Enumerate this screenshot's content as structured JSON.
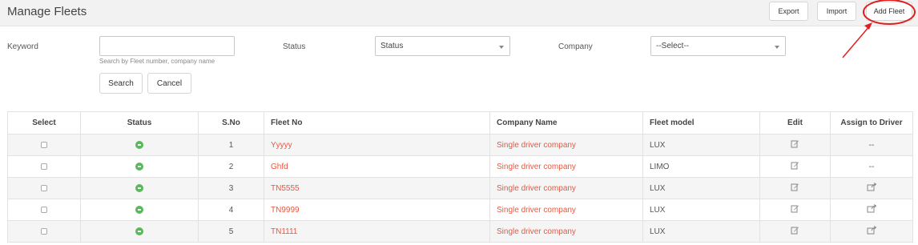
{
  "header": {
    "title": "Manage Fleets",
    "export_label": "Export",
    "import_label": "Import",
    "add_label": "Add Fleet"
  },
  "filters": {
    "keyword_label": "Keyword",
    "keyword_value": "",
    "keyword_hint": "Search by Fleet number, company name",
    "status_label": "Status",
    "status_selected": "Status",
    "company_label": "Company",
    "company_selected": "--Select--",
    "search_label": "Search",
    "cancel_label": "Cancel"
  },
  "table": {
    "headers": [
      "Select",
      "Status",
      "S.No",
      "Fleet No",
      "Company Name",
      "Fleet model",
      "Edit",
      "Assign to Driver"
    ],
    "rows": [
      {
        "sno": "1",
        "fleet_no": "Yyyyy",
        "company": "Single driver company",
        "model": "LUX",
        "assign": "--"
      },
      {
        "sno": "2",
        "fleet_no": "Ghfd",
        "company": "Single driver company",
        "model": "LIMO",
        "assign": "--"
      },
      {
        "sno": "3",
        "fleet_no": "TN5555",
        "company": "Single driver company",
        "model": "LUX",
        "assign": ""
      },
      {
        "sno": "4",
        "fleet_no": "TN9999",
        "company": "Single driver company",
        "model": "LUX",
        "assign": ""
      },
      {
        "sno": "5",
        "fleet_no": "TN1111",
        "company": "Single driver company",
        "model": "LUX",
        "assign": ""
      }
    ]
  },
  "icons": {
    "status": "active-status-icon",
    "edit": "edit-icon",
    "assign": "assign-driver-icon"
  },
  "colors": {
    "link": "#e9573f",
    "status_active": "#5cb85c",
    "annotation": "#e02020"
  }
}
